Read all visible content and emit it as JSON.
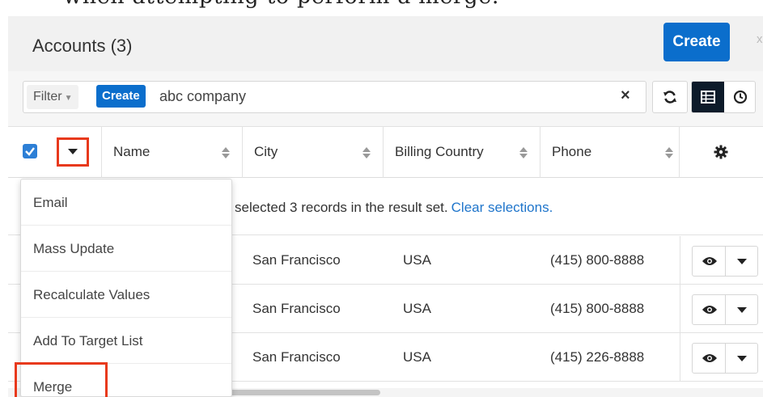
{
  "doc_text": "when attempting to perform a merge.",
  "header": {
    "title": "Accounts (3)",
    "create_label": "Create",
    "close_label": "x"
  },
  "filter": {
    "dropdown_label": "Filter",
    "create_label": "Create",
    "query": "abc company",
    "clear_label": "×"
  },
  "columns": [
    {
      "label": "Name"
    },
    {
      "label": "City"
    },
    {
      "label": "Billing Country"
    },
    {
      "label": "Phone"
    }
  ],
  "select_all": {
    "checked": true
  },
  "alert": {
    "text": "selected 3 records in the result set.",
    "link": "Clear selections."
  },
  "rows": [
    {
      "city": "San Francisco",
      "country": "USA",
      "phone": "(415) 800-8888"
    },
    {
      "city": "San Francisco",
      "country": "USA",
      "phone": "(415) 800-8888"
    },
    {
      "city": "San Francisco",
      "country": "USA",
      "phone": "(415) 226-8888"
    }
  ],
  "mass_actions_menu": {
    "items": [
      {
        "label": "Email"
      },
      {
        "label": "Mass Update"
      },
      {
        "label": "Recalculate Values"
      },
      {
        "label": "Add To Target List"
      },
      {
        "label": "Merge"
      }
    ]
  },
  "colors": {
    "primary": "#0b6ecc",
    "highlight": "#e8391c",
    "link": "#1f75cb",
    "active_toggle": "#0d1b2a"
  },
  "icons": {
    "refresh": "refresh-icon",
    "list_view": "list-view-icon",
    "activity_view": "clock-icon",
    "settings": "gear-icon",
    "preview": "eye-icon",
    "actions": "caret-down-icon"
  }
}
